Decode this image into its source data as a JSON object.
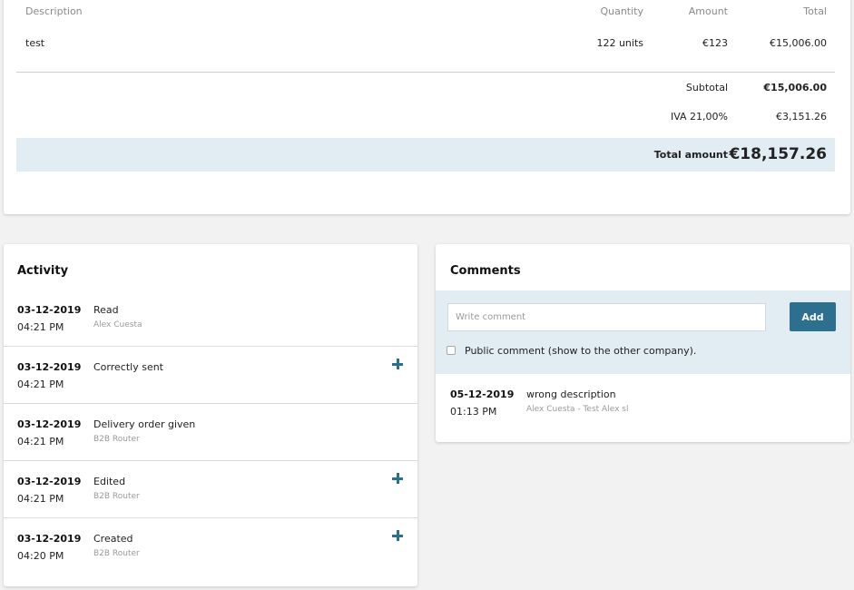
{
  "invoice": {
    "headers": {
      "description": "Description",
      "quantity": "Quantity",
      "amount": "Amount",
      "total": "Total"
    },
    "lines": [
      {
        "description": "test",
        "quantity": "122 units",
        "amount": "€123",
        "total": "€15,006.00"
      }
    ],
    "subtotal_label": "Subtotal",
    "subtotal_value": "€15,006.00",
    "tax_label": "IVA 21,00%",
    "tax_value": "€3,151.26",
    "total_label": "Total amount",
    "total_value": "€18,157.26"
  },
  "activity": {
    "title": "Activity",
    "items": [
      {
        "date": "03-12-2019",
        "time": "04:21 PM",
        "label": "Read",
        "by": "Alex Cuesta",
        "expandable": false
      },
      {
        "date": "03-12-2019",
        "time": "04:21 PM",
        "label": "Correctly sent",
        "by": "",
        "expandable": true
      },
      {
        "date": "03-12-2019",
        "time": "04:21 PM",
        "label": "Delivery order given",
        "by": "B2B Router",
        "expandable": false
      },
      {
        "date": "03-12-2019",
        "time": "04:21 PM",
        "label": "Edited",
        "by": "B2B Router",
        "expandable": true
      },
      {
        "date": "03-12-2019",
        "time": "04:20 PM",
        "label": "Created",
        "by": "B2B Router",
        "expandable": true
      }
    ]
  },
  "comments": {
    "title": "Comments",
    "input_placeholder": "Write comment",
    "add_label": "Add",
    "public_label": "Public comment (show to the other company).",
    "items": [
      {
        "date": "05-12-2019",
        "time": "01:13 PM",
        "text": "wrong description",
        "by": "Alex Cuesta - Test Alex sl"
      }
    ]
  },
  "colors": {
    "accent": "#2c6f8f",
    "highlight": "#e1ecf3"
  }
}
